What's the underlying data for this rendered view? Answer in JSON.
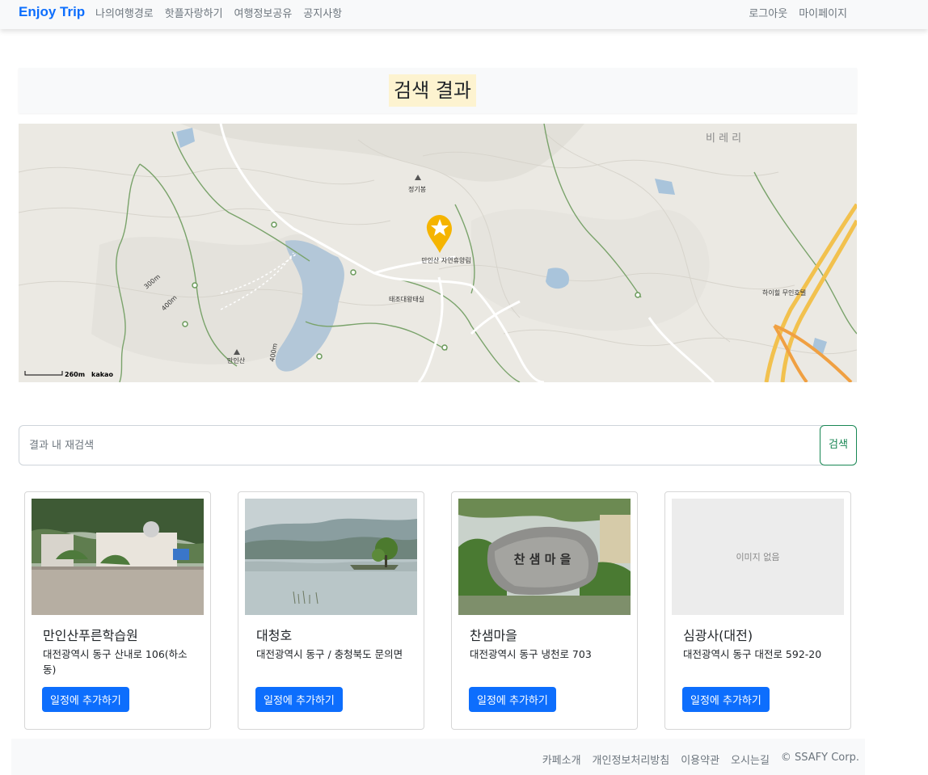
{
  "navbar": {
    "brand": "Enjoy Trip",
    "left_links": [
      "나의여행경로",
      "핫플자랑하기",
      "여행정보공유",
      "공지사항"
    ],
    "right_links": [
      "로그아웃",
      "마이페이지"
    ]
  },
  "page": {
    "title": "검색 결과"
  },
  "map": {
    "labels": {
      "peak": "정기봉",
      "forest": "만인산\n자연휴양림",
      "site": "태조대왕태실",
      "motel": "하이힐\n무인호텔",
      "mountain": "만인산",
      "village": "비 레 리",
      "scale": "260m",
      "provider": "kakao",
      "contour_300": "300m",
      "contour_400": "400m",
      "contour_400b": "400m"
    },
    "marker_icon": "star-marker-icon"
  },
  "search": {
    "placeholder": "결과 내 재검색",
    "value": "",
    "button_label": "검색"
  },
  "results": [
    {
      "title": "만인산푸른학습원",
      "address": "대전광역시 동구 산내로 106(하소동)",
      "button": "일정에 추가하기",
      "image": "photo"
    },
    {
      "title": "대청호",
      "address": "대전광역시 동구 / 충청북도 문의면",
      "button": "일정에 추가하기",
      "image": "photo"
    },
    {
      "title": "찬샘마을",
      "address": "대전광역시 동구 냉천로 703",
      "button": "일정에 추가하기",
      "image": "photo",
      "stone_text": "찬 샘 마 을"
    },
    {
      "title": "심광사(대전)",
      "address": "대전광역시 동구 대전로 592-20",
      "button": "일정에 추가하기",
      "image": "none",
      "no_image_text": "이미지 없음"
    }
  ],
  "footer": {
    "links": [
      "카페소개",
      "개인정보처리방침",
      "이용약관",
      "오시는길",
      "© SSAFY Corp."
    ]
  },
  "colors": {
    "brand": "#0d6efd",
    "primary_button": "#0d6efd",
    "search_button": "#198754",
    "title_highlight": "#fdf3d0"
  }
}
